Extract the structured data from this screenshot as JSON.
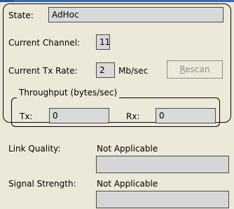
{
  "status_panel": {
    "state_label": "State:",
    "state_value": "AdHoc",
    "channel_label": "Current Channel:",
    "channel_value": "11",
    "tx_rate_label": "Current Tx Rate:",
    "tx_rate_value": "2",
    "tx_rate_unit": "Mb/sec",
    "rescan_prefix": "R",
    "rescan_rest": "escan",
    "throughput": {
      "title": "Throughput (bytes/sec)",
      "tx_label": "Tx:",
      "tx_value": "0",
      "rx_label": "Rx:",
      "rx_value": "0"
    }
  },
  "link_quality": {
    "label": "Link Quality:",
    "value": "Not Applicable"
  },
  "signal_strength": {
    "label": "Signal Strength:",
    "value": "Not Applicable"
  },
  "colors": {
    "background": "#ece9d8",
    "field": "#d9d9d9",
    "disabled_text": "#8e8e8e",
    "top_bar": "#3169c6"
  }
}
